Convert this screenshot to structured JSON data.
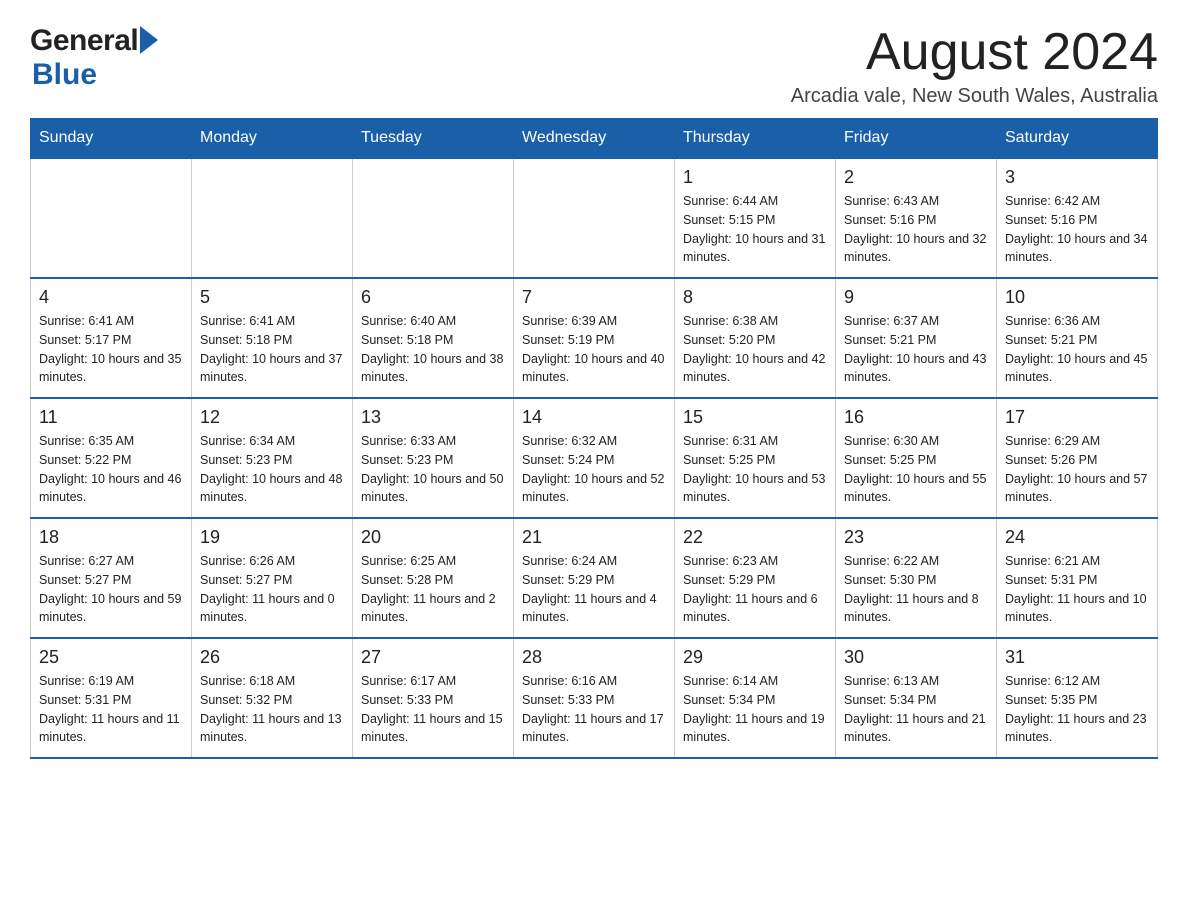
{
  "header": {
    "month_title": "August 2024",
    "location": "Arcadia vale, New South Wales, Australia",
    "logo_general": "General",
    "logo_blue": "Blue"
  },
  "days_of_week": [
    "Sunday",
    "Monday",
    "Tuesday",
    "Wednesday",
    "Thursday",
    "Friday",
    "Saturday"
  ],
  "weeks": [
    [
      {
        "day": "",
        "sunrise": "",
        "sunset": "",
        "daylight": ""
      },
      {
        "day": "",
        "sunrise": "",
        "sunset": "",
        "daylight": ""
      },
      {
        "day": "",
        "sunrise": "",
        "sunset": "",
        "daylight": ""
      },
      {
        "day": "",
        "sunrise": "",
        "sunset": "",
        "daylight": ""
      },
      {
        "day": "1",
        "sunrise": "Sunrise: 6:44 AM",
        "sunset": "Sunset: 5:15 PM",
        "daylight": "Daylight: 10 hours and 31 minutes."
      },
      {
        "day": "2",
        "sunrise": "Sunrise: 6:43 AM",
        "sunset": "Sunset: 5:16 PM",
        "daylight": "Daylight: 10 hours and 32 minutes."
      },
      {
        "day": "3",
        "sunrise": "Sunrise: 6:42 AM",
        "sunset": "Sunset: 5:16 PM",
        "daylight": "Daylight: 10 hours and 34 minutes."
      }
    ],
    [
      {
        "day": "4",
        "sunrise": "Sunrise: 6:41 AM",
        "sunset": "Sunset: 5:17 PM",
        "daylight": "Daylight: 10 hours and 35 minutes."
      },
      {
        "day": "5",
        "sunrise": "Sunrise: 6:41 AM",
        "sunset": "Sunset: 5:18 PM",
        "daylight": "Daylight: 10 hours and 37 minutes."
      },
      {
        "day": "6",
        "sunrise": "Sunrise: 6:40 AM",
        "sunset": "Sunset: 5:18 PM",
        "daylight": "Daylight: 10 hours and 38 minutes."
      },
      {
        "day": "7",
        "sunrise": "Sunrise: 6:39 AM",
        "sunset": "Sunset: 5:19 PM",
        "daylight": "Daylight: 10 hours and 40 minutes."
      },
      {
        "day": "8",
        "sunrise": "Sunrise: 6:38 AM",
        "sunset": "Sunset: 5:20 PM",
        "daylight": "Daylight: 10 hours and 42 minutes."
      },
      {
        "day": "9",
        "sunrise": "Sunrise: 6:37 AM",
        "sunset": "Sunset: 5:21 PM",
        "daylight": "Daylight: 10 hours and 43 minutes."
      },
      {
        "day": "10",
        "sunrise": "Sunrise: 6:36 AM",
        "sunset": "Sunset: 5:21 PM",
        "daylight": "Daylight: 10 hours and 45 minutes."
      }
    ],
    [
      {
        "day": "11",
        "sunrise": "Sunrise: 6:35 AM",
        "sunset": "Sunset: 5:22 PM",
        "daylight": "Daylight: 10 hours and 46 minutes."
      },
      {
        "day": "12",
        "sunrise": "Sunrise: 6:34 AM",
        "sunset": "Sunset: 5:23 PM",
        "daylight": "Daylight: 10 hours and 48 minutes."
      },
      {
        "day": "13",
        "sunrise": "Sunrise: 6:33 AM",
        "sunset": "Sunset: 5:23 PM",
        "daylight": "Daylight: 10 hours and 50 minutes."
      },
      {
        "day": "14",
        "sunrise": "Sunrise: 6:32 AM",
        "sunset": "Sunset: 5:24 PM",
        "daylight": "Daylight: 10 hours and 52 minutes."
      },
      {
        "day": "15",
        "sunrise": "Sunrise: 6:31 AM",
        "sunset": "Sunset: 5:25 PM",
        "daylight": "Daylight: 10 hours and 53 minutes."
      },
      {
        "day": "16",
        "sunrise": "Sunrise: 6:30 AM",
        "sunset": "Sunset: 5:25 PM",
        "daylight": "Daylight: 10 hours and 55 minutes."
      },
      {
        "day": "17",
        "sunrise": "Sunrise: 6:29 AM",
        "sunset": "Sunset: 5:26 PM",
        "daylight": "Daylight: 10 hours and 57 minutes."
      }
    ],
    [
      {
        "day": "18",
        "sunrise": "Sunrise: 6:27 AM",
        "sunset": "Sunset: 5:27 PM",
        "daylight": "Daylight: 10 hours and 59 minutes."
      },
      {
        "day": "19",
        "sunrise": "Sunrise: 6:26 AM",
        "sunset": "Sunset: 5:27 PM",
        "daylight": "Daylight: 11 hours and 0 minutes."
      },
      {
        "day": "20",
        "sunrise": "Sunrise: 6:25 AM",
        "sunset": "Sunset: 5:28 PM",
        "daylight": "Daylight: 11 hours and 2 minutes."
      },
      {
        "day": "21",
        "sunrise": "Sunrise: 6:24 AM",
        "sunset": "Sunset: 5:29 PM",
        "daylight": "Daylight: 11 hours and 4 minutes."
      },
      {
        "day": "22",
        "sunrise": "Sunrise: 6:23 AM",
        "sunset": "Sunset: 5:29 PM",
        "daylight": "Daylight: 11 hours and 6 minutes."
      },
      {
        "day": "23",
        "sunrise": "Sunrise: 6:22 AM",
        "sunset": "Sunset: 5:30 PM",
        "daylight": "Daylight: 11 hours and 8 minutes."
      },
      {
        "day": "24",
        "sunrise": "Sunrise: 6:21 AM",
        "sunset": "Sunset: 5:31 PM",
        "daylight": "Daylight: 11 hours and 10 minutes."
      }
    ],
    [
      {
        "day": "25",
        "sunrise": "Sunrise: 6:19 AM",
        "sunset": "Sunset: 5:31 PM",
        "daylight": "Daylight: 11 hours and 11 minutes."
      },
      {
        "day": "26",
        "sunrise": "Sunrise: 6:18 AM",
        "sunset": "Sunset: 5:32 PM",
        "daylight": "Daylight: 11 hours and 13 minutes."
      },
      {
        "day": "27",
        "sunrise": "Sunrise: 6:17 AM",
        "sunset": "Sunset: 5:33 PM",
        "daylight": "Daylight: 11 hours and 15 minutes."
      },
      {
        "day": "28",
        "sunrise": "Sunrise: 6:16 AM",
        "sunset": "Sunset: 5:33 PM",
        "daylight": "Daylight: 11 hours and 17 minutes."
      },
      {
        "day": "29",
        "sunrise": "Sunrise: 6:14 AM",
        "sunset": "Sunset: 5:34 PM",
        "daylight": "Daylight: 11 hours and 19 minutes."
      },
      {
        "day": "30",
        "sunrise": "Sunrise: 6:13 AM",
        "sunset": "Sunset: 5:34 PM",
        "daylight": "Daylight: 11 hours and 21 minutes."
      },
      {
        "day": "31",
        "sunrise": "Sunrise: 6:12 AM",
        "sunset": "Sunset: 5:35 PM",
        "daylight": "Daylight: 11 hours and 23 minutes."
      }
    ]
  ]
}
